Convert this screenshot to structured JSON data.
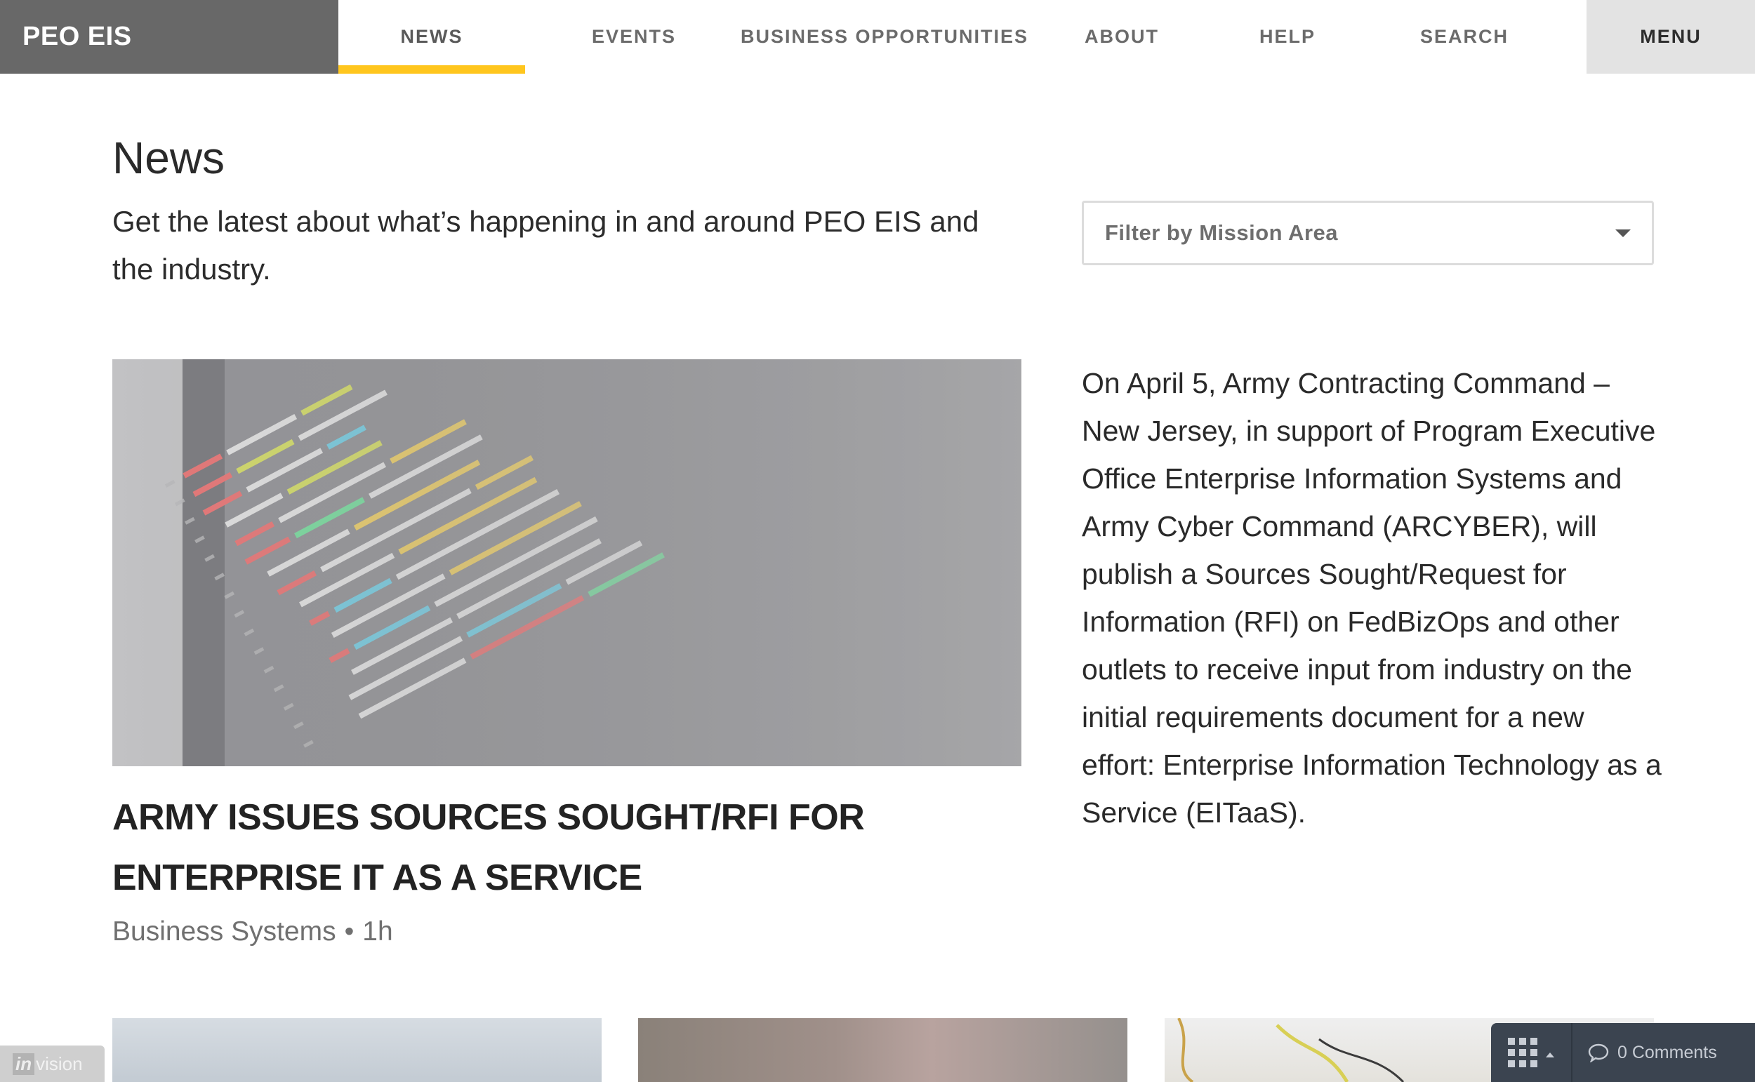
{
  "nav": {
    "brand": "PEO EIS",
    "items": [
      {
        "label": "NEWS",
        "active": true
      },
      {
        "label": "EVENTS"
      },
      {
        "label": "BUSINESS OPPORTUNITIES"
      },
      {
        "label": "ABOUT"
      },
      {
        "label": "HELP"
      },
      {
        "label": "SEARCH"
      }
    ],
    "menu_label": "MENU",
    "accent_color": "#ffc61e"
  },
  "header": {
    "title": "News",
    "intro": "Get the latest about what’s happening in and around PEO EIS and the industry.",
    "filter_label": "Filter by Mission Area"
  },
  "featured": {
    "headline": "ARMY ISSUES SOURCES SOUGHT/RFI FOR ENTERPRISE IT AS A SERVICE",
    "category": "Business Systems",
    "separator": "•",
    "age": "1h",
    "summary": "On April 5, Army Contracting Command – New Jersey, in support of Program Executive Office Enterprise Information Systems and Army Cyber Command (ARCYBER), will publish a Sources Sought/Request for Information (RFI) on FedBizOps and other outlets to receive input from industry on the initial requirements document for a new effort: Enterprise Information Technology as a Service (EITaaS)."
  },
  "invision": {
    "in": "in",
    "vision": "vision"
  },
  "comments_bar": {
    "label": "0 Comments"
  }
}
